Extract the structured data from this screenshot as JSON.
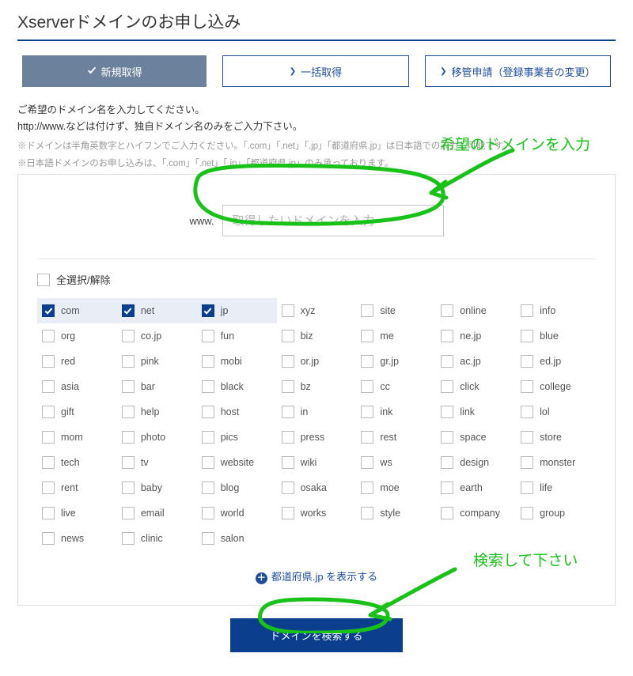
{
  "page_title": "Xserverドメインのお申し込み",
  "tabs": {
    "new": "新規取得",
    "bulk": "一括取得",
    "transfer": "移管申請（登録事業者の変更）"
  },
  "description1": "ご希望のドメイン名を入力してください。",
  "description2": "http://www.などは付けず、独自ドメイン名のみをご入力下さい。",
  "note1": "※ドメインは半角英数字とハイフンでご入力ください。「.com」「.net」「.jp」「都道府県.jp」は日本語での入力も可能です。",
  "note2": "※日本語ドメインのお申し込みは、「.com」「.net」「.jp」「都道府県.jp」のみ承っております。",
  "www_label": "www.",
  "domain_placeholder": "取得したいドメインを入力",
  "select_all_label": "全選択/解除",
  "tlds": [
    {
      "label": "com",
      "checked": true,
      "hl": true
    },
    {
      "label": "net",
      "checked": true,
      "hl": true
    },
    {
      "label": "jp",
      "checked": true,
      "hl": true
    },
    {
      "label": "xyz",
      "checked": false,
      "hl": false
    },
    {
      "label": "site",
      "checked": false,
      "hl": false
    },
    {
      "label": "online",
      "checked": false,
      "hl": false
    },
    {
      "label": "info",
      "checked": false,
      "hl": false
    },
    {
      "label": "org",
      "checked": false,
      "hl": false
    },
    {
      "label": "co.jp",
      "checked": false,
      "hl": false
    },
    {
      "label": "fun",
      "checked": false,
      "hl": false
    },
    {
      "label": "biz",
      "checked": false,
      "hl": false
    },
    {
      "label": "me",
      "checked": false,
      "hl": false
    },
    {
      "label": "ne.jp",
      "checked": false,
      "hl": false
    },
    {
      "label": "blue",
      "checked": false,
      "hl": false
    },
    {
      "label": "red",
      "checked": false,
      "hl": false
    },
    {
      "label": "pink",
      "checked": false,
      "hl": false
    },
    {
      "label": "mobi",
      "checked": false,
      "hl": false
    },
    {
      "label": "or.jp",
      "checked": false,
      "hl": false
    },
    {
      "label": "gr.jp",
      "checked": false,
      "hl": false
    },
    {
      "label": "ac.jp",
      "checked": false,
      "hl": false
    },
    {
      "label": "ed.jp",
      "checked": false,
      "hl": false
    },
    {
      "label": "asia",
      "checked": false,
      "hl": false
    },
    {
      "label": "bar",
      "checked": false,
      "hl": false
    },
    {
      "label": "black",
      "checked": false,
      "hl": false
    },
    {
      "label": "bz",
      "checked": false,
      "hl": false
    },
    {
      "label": "cc",
      "checked": false,
      "hl": false
    },
    {
      "label": "click",
      "checked": false,
      "hl": false
    },
    {
      "label": "college",
      "checked": false,
      "hl": false
    },
    {
      "label": "gift",
      "checked": false,
      "hl": false
    },
    {
      "label": "help",
      "checked": false,
      "hl": false
    },
    {
      "label": "host",
      "checked": false,
      "hl": false
    },
    {
      "label": "in",
      "checked": false,
      "hl": false
    },
    {
      "label": "ink",
      "checked": false,
      "hl": false
    },
    {
      "label": "link",
      "checked": false,
      "hl": false
    },
    {
      "label": "lol",
      "checked": false,
      "hl": false
    },
    {
      "label": "mom",
      "checked": false,
      "hl": false
    },
    {
      "label": "photo",
      "checked": false,
      "hl": false
    },
    {
      "label": "pics",
      "checked": false,
      "hl": false
    },
    {
      "label": "press",
      "checked": false,
      "hl": false
    },
    {
      "label": "rest",
      "checked": false,
      "hl": false
    },
    {
      "label": "space",
      "checked": false,
      "hl": false
    },
    {
      "label": "store",
      "checked": false,
      "hl": false
    },
    {
      "label": "tech",
      "checked": false,
      "hl": false
    },
    {
      "label": "tv",
      "checked": false,
      "hl": false
    },
    {
      "label": "website",
      "checked": false,
      "hl": false
    },
    {
      "label": "wiki",
      "checked": false,
      "hl": false
    },
    {
      "label": "ws",
      "checked": false,
      "hl": false
    },
    {
      "label": "design",
      "checked": false,
      "hl": false
    },
    {
      "label": "monster",
      "checked": false,
      "hl": false
    },
    {
      "label": "rent",
      "checked": false,
      "hl": false
    },
    {
      "label": "baby",
      "checked": false,
      "hl": false
    },
    {
      "label": "blog",
      "checked": false,
      "hl": false
    },
    {
      "label": "osaka",
      "checked": false,
      "hl": false
    },
    {
      "label": "moe",
      "checked": false,
      "hl": false
    },
    {
      "label": "earth",
      "checked": false,
      "hl": false
    },
    {
      "label": "life",
      "checked": false,
      "hl": false
    },
    {
      "label": "live",
      "checked": false,
      "hl": false
    },
    {
      "label": "email",
      "checked": false,
      "hl": false
    },
    {
      "label": "world",
      "checked": false,
      "hl": false
    },
    {
      "label": "works",
      "checked": false,
      "hl": false
    },
    {
      "label": "style",
      "checked": false,
      "hl": false
    },
    {
      "label": "company",
      "checked": false,
      "hl": false
    },
    {
      "label": "group",
      "checked": false,
      "hl": false
    },
    {
      "label": "news",
      "checked": false,
      "hl": false
    },
    {
      "label": "clinic",
      "checked": false,
      "hl": false
    },
    {
      "label": "salon",
      "checked": false,
      "hl": false
    }
  ],
  "show_pref_label": "都道府県.jp を表示する",
  "search_button": "ドメインを検索する",
  "annotations": {
    "input_hint": "希望のドメインを入力",
    "search_hint": "検索して下さい"
  }
}
